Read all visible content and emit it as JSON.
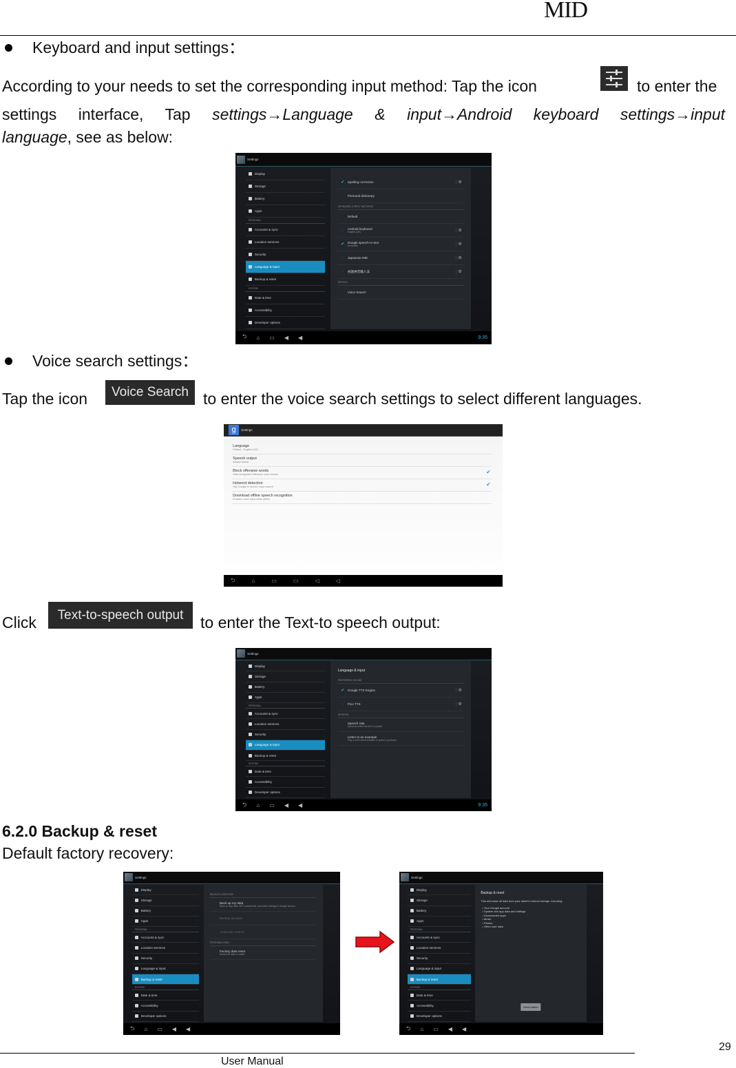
{
  "header": {
    "title": "MID"
  },
  "footer": {
    "label": "User Manual",
    "page_number": "29"
  },
  "section_keyboard": {
    "bullet": "Keyboard and input settings：",
    "line1_a": "According to your needs to set the corresponding input method: Tap the icon",
    "line1_icon": "settings-sliders-icon",
    "line1_b": "to enter the",
    "line2": {
      "a": "settings",
      "b": "interface,",
      "c": "Tap",
      "path1": "settings",
      "arrow": "→",
      "path2": "Language",
      "amp": "&",
      "path3": "input",
      "path4": "Android",
      "path5": "keyboard",
      "path6": "settings",
      "path7": "input"
    },
    "line3_italic": "language",
    "line3_rest": ", see as below:"
  },
  "section_voice": {
    "bullet": "Voice search settings：",
    "line_a": "Tap the icon",
    "button": "Voice Search",
    "line_b": "to enter the voice search settings to select different languages.",
    "click_a": "Click",
    "tts_button": "Text-to-speech output",
    "click_b": "to enter the Text-to speech output:"
  },
  "section_backup": {
    "heading": "6.2.0 Backup & reset",
    "subheading": "Default factory recovery:"
  },
  "colors": {
    "highlight": "#1a8dc0",
    "arrow": "#e8141b",
    "check": "#33b5e5"
  },
  "screens": [
    {
      "kind": "dark",
      "app_title": "Settings",
      "selected": "Language & input",
      "time": "9:35",
      "panel": {
        "title": "",
        "rows": [
          {
            "check": true,
            "title": "Spelling correction",
            "settings": true
          },
          {
            "title": "Personal dictionary"
          },
          {
            "section": "KEYBOARD & INPUT METHODS"
          },
          {
            "title": "Default"
          },
          {
            "check": false,
            "title": "Android keyboard",
            "sub": "English (US)",
            "settings": true
          },
          {
            "check": true,
            "title": "Google speech-to-text",
            "sub": "Automatic",
            "settings": true
          },
          {
            "check": false,
            "title": "Japanese IME",
            "settings": true
          },
          {
            "check": false,
            "title": "谷歌拼音输入法",
            "settings": true
          },
          {
            "section": "SPEECH"
          },
          {
            "title": "Voice Search"
          }
        ]
      }
    },
    {
      "kind": "light",
      "app_title": "Settings",
      "rows": [
        {
          "title": "Language",
          "sub": "Default - English (US)"
        },
        {
          "title": "Speech output",
          "sub": "Always speak"
        },
        {
          "title": "Block offensive words",
          "sub": "Hide recognized offensive voice results",
          "check": true
        },
        {
          "title": "Hotword detection",
          "sub": "Say Google to launch voice search",
          "check": true
        },
        {
          "title": "Download offline speech recognition",
          "sub": "Enables voice input while offline"
        }
      ]
    },
    {
      "kind": "dark",
      "app_title": "Settings",
      "selected": "Language & input",
      "time": "9:35",
      "panel": {
        "title": "Language & input",
        "rows": [
          {
            "section": "PREFERRED ENGINE"
          },
          {
            "check": true,
            "title": "Google TTS Engine",
            "settings": true
          },
          {
            "check": false,
            "title": "Pico TTS",
            "settings": true
          },
          {
            "section": "GENERAL"
          },
          {
            "title": "Speech rate",
            "sub": "Speed at which the text is spoken"
          },
          {
            "title": "Listen to an example",
            "sub": "Play a short demonstration of speech synthesis"
          }
        ]
      }
    },
    {
      "kind": "dark",
      "app_title": "Settings",
      "selected": "Backup & reset",
      "time": "",
      "panel": {
        "title": "",
        "rows": [
          {
            "section": "BACKUP & RESTORE"
          },
          {
            "title": "Back up my data",
            "sub": "Back up app data, Wi-Fi passwords, and other settings to Google servers"
          },
          {
            "title": "Backup account",
            "dim": true
          },
          {
            "title": "Automatic restore",
            "dim": true
          },
          {
            "section": "PERSONAL DATA"
          },
          {
            "title": "Factory data reset",
            "sub": "Erases all data on tablet"
          }
        ]
      }
    },
    {
      "kind": "dark",
      "app_title": "Settings",
      "selected": "Backup & reset",
      "time": "",
      "panel": {
        "title": "Backup & reset",
        "body": "This will erase all data from your tablet's internal storage, including:",
        "list": [
          "Your Google account",
          "System and app data and settings",
          "Downloaded apps",
          "Music",
          "Photos",
          "Other user data"
        ],
        "button": "Reset tablet",
        "rows": []
      }
    }
  ],
  "sidebar": [
    {
      "label": "Display"
    },
    {
      "label": "Storage"
    },
    {
      "label": "Battery"
    },
    {
      "label": "Apps"
    },
    {
      "section": "PERSONAL"
    },
    {
      "label": "Accounts & sync"
    },
    {
      "label": "Location services"
    },
    {
      "label": "Security"
    },
    {
      "label": "Language & input"
    },
    {
      "label": "Backup & reset"
    },
    {
      "section": "SYSTEM"
    },
    {
      "label": "Date & time"
    },
    {
      "label": "Accessibility"
    },
    {
      "label": "Developer options"
    }
  ]
}
